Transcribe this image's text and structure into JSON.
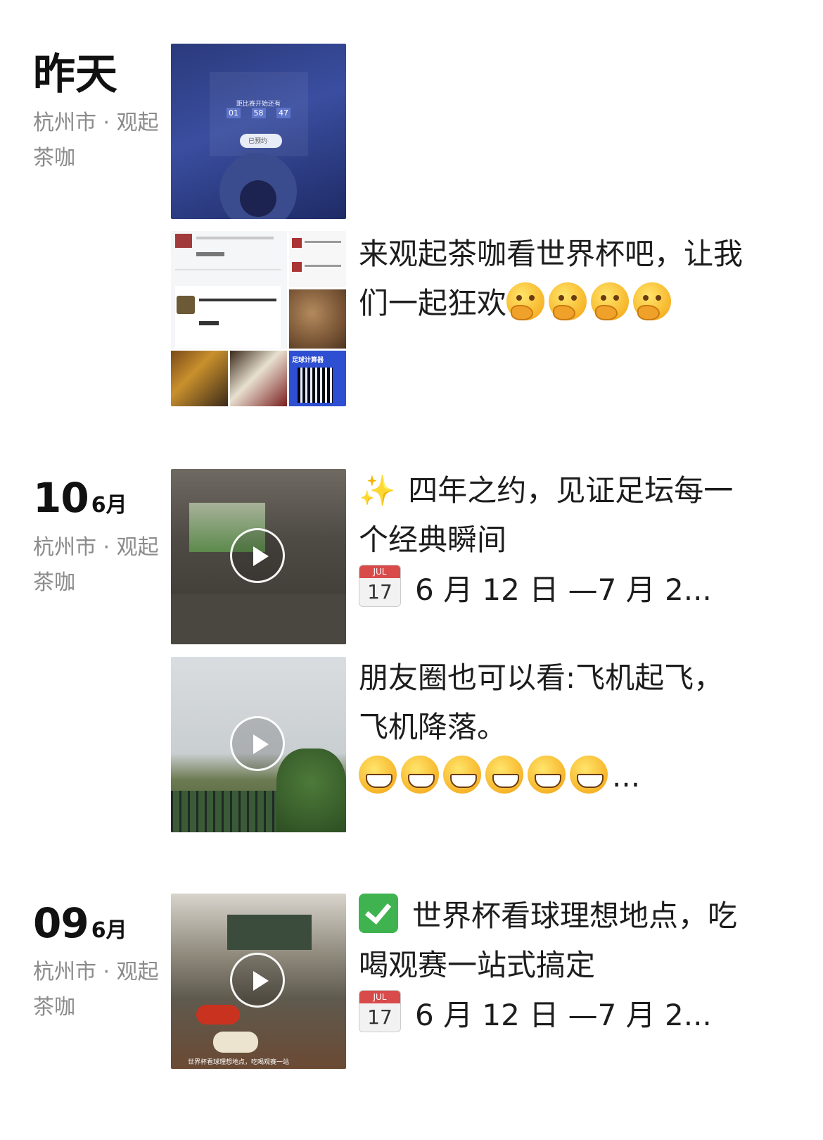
{
  "groups": [
    {
      "date_word": "昨天",
      "location": "杭州市 · 观起茶咖",
      "posts": [
        {
          "type": "image",
          "thumb_text": [
            "距比赛开始还有",
            "01",
            "58",
            "47",
            "已预约"
          ]
        },
        {
          "type": "grid",
          "text_main": "来观起茶咖看世界杯吧，让我们一起狂欢",
          "emoji": "thinking",
          "emoji_count": 4,
          "grid_labels": [
            "足球计算器"
          ]
        }
      ]
    },
    {
      "day": "10",
      "month": "6月",
      "location": "杭州市 · 观起茶咖",
      "posts": [
        {
          "type": "video",
          "line1": "四年之约，见证足坛每一个经典瞬间",
          "line2": "6 月 12 日 —7 月 2...",
          "cal_month": "JUL",
          "cal_day": "17"
        },
        {
          "type": "video",
          "text_main": "朋友圈也可以看:飞机起飞，飞机降落。",
          "emoji": "grin",
          "emoji_count": 6,
          "ellipsis": "..."
        }
      ]
    },
    {
      "day": "09",
      "month": "6月",
      "location": "杭州市 · 观起茶咖",
      "posts": [
        {
          "type": "video",
          "line1": "世界杯看球理想地点，吃喝观赛一站式搞定",
          "line2": "6 月 12 日 —7 月 2...",
          "cal_month": "JUL",
          "cal_day": "17",
          "caption": "世界杯看球理想地点，吃喝观赛一站"
        }
      ]
    }
  ]
}
